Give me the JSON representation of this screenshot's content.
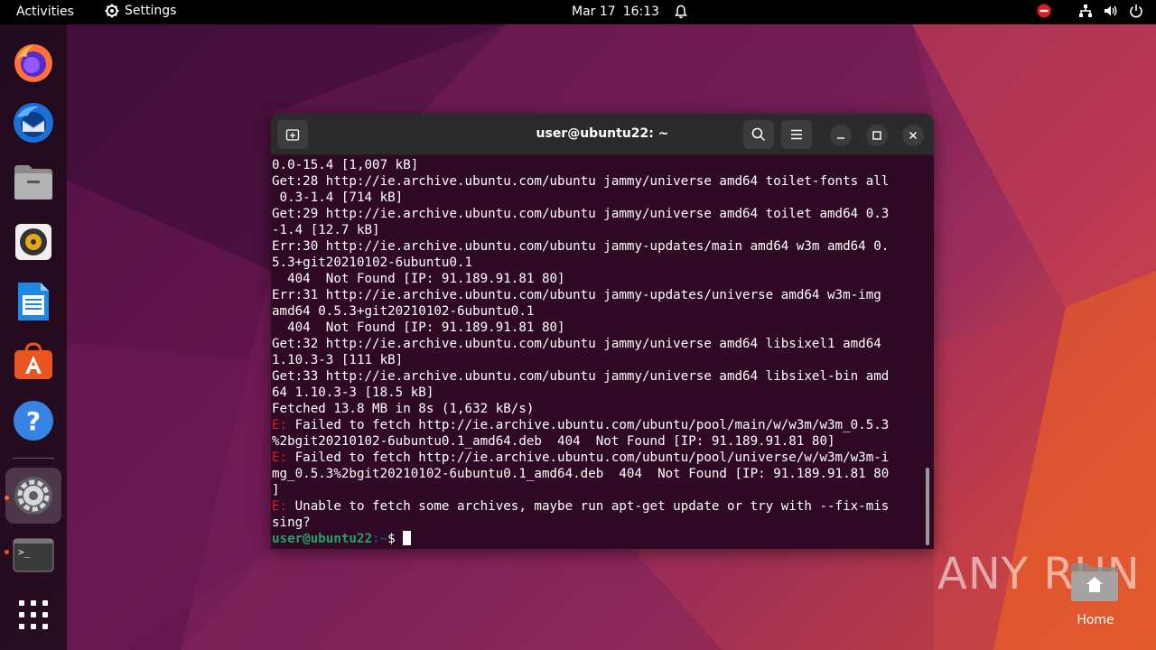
{
  "topbar": {
    "activities": "Activities",
    "app_name": "Settings",
    "date": "Mar 17",
    "time": "16:13"
  },
  "dock": {
    "items": [
      "firefox-icon",
      "thunderbird-icon",
      "files-icon",
      "rhythmbox-icon",
      "writer-icon",
      "software-icon",
      "help-icon",
      "settings-icon",
      "terminal-icon",
      "apps-grid-icon"
    ]
  },
  "terminal": {
    "title": "user@ubuntu22: ~",
    "lines": [
      {
        "text": "0.0-15.4 [1,007 kB]"
      },
      {
        "text": "Get:28 http://ie.archive.ubuntu.com/ubuntu jammy/universe amd64 toilet-fonts all"
      },
      {
        "text": " 0.3-1.4 [714 kB]"
      },
      {
        "text": "Get:29 http://ie.archive.ubuntu.com/ubuntu jammy/universe amd64 toilet amd64 0.3"
      },
      {
        "text": "-1.4 [12.7 kB]"
      },
      {
        "text": "Err:30 http://ie.archive.ubuntu.com/ubuntu jammy-updates/main amd64 w3m amd64 0."
      },
      {
        "text": "5.3+git20210102-6ubuntu0.1"
      },
      {
        "text": "  404  Not Found [IP: 91.189.91.81 80]"
      },
      {
        "text": "Err:31 http://ie.archive.ubuntu.com/ubuntu jammy-updates/universe amd64 w3m-img"
      },
      {
        "text": "amd64 0.5.3+git20210102-6ubuntu0.1"
      },
      {
        "text": "  404  Not Found [IP: 91.189.91.81 80]"
      },
      {
        "text": "Get:32 http://ie.archive.ubuntu.com/ubuntu jammy/universe amd64 libsixel1 amd64"
      },
      {
        "text": "1.10.3-3 [111 kB]"
      },
      {
        "text": "Get:33 http://ie.archive.ubuntu.com/ubuntu jammy/universe amd64 libsixel-bin amd"
      },
      {
        "text": "64 1.10.3-3 [18.5 kB]"
      },
      {
        "text": "Fetched 13.8 MB in 8s (1,632 kB/s)"
      },
      {
        "prefix": "E:",
        "text": " Failed to fetch http://ie.archive.ubuntu.com/ubuntu/pool/main/w/w3m/w3m_0.5.3"
      },
      {
        "text": "%2bgit20210102-6ubuntu0.1_amd64.deb  404  Not Found [IP: 91.189.91.81 80]"
      },
      {
        "prefix": "E:",
        "text": " Failed to fetch http://ie.archive.ubuntu.com/ubuntu/pool/universe/w/w3m/w3m-i"
      },
      {
        "text": "mg_0.5.3%2bgit20210102-6ubuntu0.1_amd64.deb  404  Not Found [IP: 91.189.91.81 80"
      },
      {
        "text": "]"
      },
      {
        "prefix": "E:",
        "text": " Unable to fetch some archives, maybe run apt-get update or try with --fix-mis"
      },
      {
        "text": "sing?"
      }
    ],
    "prompt_user": "user@ubuntu22",
    "prompt_path": ":~",
    "prompt_symbol": "$ "
  },
  "watermark": {
    "text": "ANY RUN",
    "home_label": "Home"
  },
  "colors": {
    "terminal_bg": "#300a24",
    "error_red": "#e01b24",
    "prompt_green": "#26a269",
    "ubuntu_orange": "#e95420"
  }
}
